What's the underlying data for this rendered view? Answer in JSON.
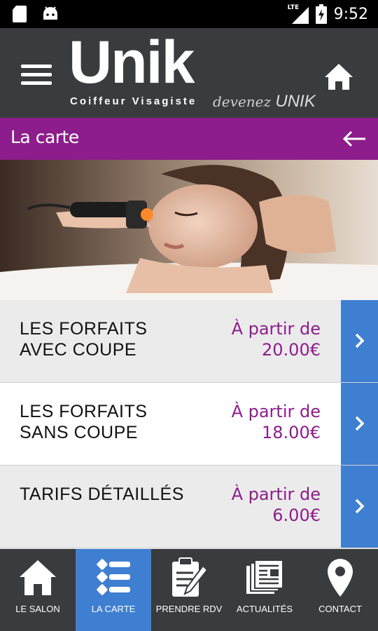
{
  "status_bar": {
    "time": "9:52",
    "network": "LTE",
    "icons": [
      "sd-card-icon",
      "android-icon",
      "signal-icon",
      "battery-icon"
    ]
  },
  "header": {
    "logo_main": "Unik",
    "logo_tagline": "Coiffeur Visagiste",
    "logo_slogan_word": "devenez",
    "logo_slogan_brand": "UNIK"
  },
  "title_bar": {
    "title": "La carte",
    "accent_color": "#8d1d8c"
  },
  "hero": {
    "image": "woman-face-treatment-photo"
  },
  "services": [
    {
      "label_line1": "LES FORFAITS",
      "label_line2": "AVEC COUPE",
      "price_prefix": "À partir de",
      "price": "20.00€"
    },
    {
      "label_line1": "LES FORFAITS",
      "label_line2": "SANS COUPE",
      "price_prefix": "À partir de",
      "price": "18.00€"
    },
    {
      "label_line1": "TARIFS DÉTAILLÉS",
      "label_line2": "",
      "price_prefix": "À partir de",
      "price": "6.00€"
    }
  ],
  "bottom_nav": [
    {
      "label": "LE SALON",
      "icon": "home-icon",
      "active": false
    },
    {
      "label": "LA CARTE",
      "icon": "list-icon",
      "active": true
    },
    {
      "label": "PRENDRE RDV",
      "icon": "clipboard-pen-icon",
      "active": false
    },
    {
      "label": "ACTUALITÉS",
      "icon": "newspaper-icon",
      "active": false
    },
    {
      "label": "CONTACT",
      "icon": "location-pin-icon",
      "active": false
    }
  ],
  "colors": {
    "header_bg": "#3a3b3d",
    "accent_purple": "#8d1d8c",
    "accent_blue": "#3f7fd1"
  }
}
